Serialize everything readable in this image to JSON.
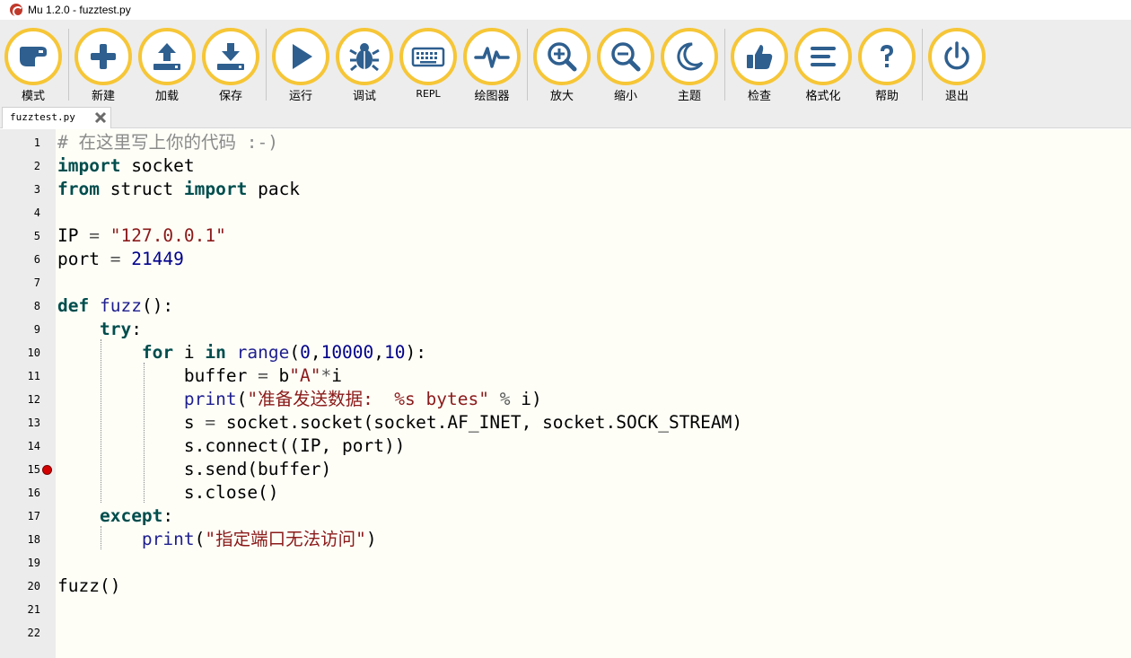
{
  "window": {
    "title": "Mu 1.2.0 - fuzztest.py"
  },
  "toolbar": {
    "buttons": [
      {
        "id": "mode",
        "label": "模式",
        "icon": "mode-icon"
      },
      {
        "id": "new",
        "label": "新建",
        "icon": "plus-icon"
      },
      {
        "id": "load",
        "label": "加载",
        "icon": "upload-icon"
      },
      {
        "id": "save",
        "label": "保存",
        "icon": "download-icon"
      },
      {
        "id": "run",
        "label": "运行",
        "icon": "play-icon"
      },
      {
        "id": "debug",
        "label": "调试",
        "icon": "bug-icon"
      },
      {
        "id": "repl",
        "label": "REPL",
        "icon": "keyboard-icon"
      },
      {
        "id": "plotter",
        "label": "绘图器",
        "icon": "pulse-icon"
      },
      {
        "id": "zoom_in",
        "label": "放大",
        "icon": "zoom-in-icon"
      },
      {
        "id": "zoom_out",
        "label": "缩小",
        "icon": "zoom-out-icon"
      },
      {
        "id": "theme",
        "label": "主题",
        "icon": "moon-icon"
      },
      {
        "id": "check",
        "label": "检查",
        "icon": "thumbs-up-icon"
      },
      {
        "id": "tidy",
        "label": "格式化",
        "icon": "lines-icon"
      },
      {
        "id": "help",
        "label": "帮助",
        "icon": "question-icon"
      },
      {
        "id": "quit",
        "label": "退出",
        "icon": "power-icon"
      }
    ],
    "accent_color": "#f6c637",
    "icon_color": "#2e5f8f"
  },
  "tabs": [
    {
      "name": "fuzztest.py",
      "close_icon": "close-icon"
    }
  ],
  "editor": {
    "line_numbers": [
      "1",
      "2",
      "3",
      "4",
      "5",
      "6",
      "7",
      "8",
      "9",
      "10",
      "11",
      "12",
      "13",
      "14",
      "15",
      "16",
      "17",
      "18",
      "19",
      "20",
      "21",
      "22"
    ],
    "breakpoint_line": "15",
    "lines": [
      [
        {
          "t": "# 在这里写上你的代码 :-)",
          "c": "cm"
        }
      ],
      [
        {
          "t": "import",
          "c": "kw"
        },
        {
          "t": " socket"
        }
      ],
      [
        {
          "t": "from",
          "c": "kw"
        },
        {
          "t": " struct "
        },
        {
          "t": "import",
          "c": "kw"
        },
        {
          "t": " pack"
        }
      ],
      [],
      [
        {
          "t": "IP "
        },
        {
          "t": "=",
          "c": "op"
        },
        {
          "t": " "
        },
        {
          "t": "\"127.0.0.1\"",
          "c": "str"
        }
      ],
      [
        {
          "t": "port "
        },
        {
          "t": "=",
          "c": "op"
        },
        {
          "t": " "
        },
        {
          "t": "21449",
          "c": "num"
        }
      ],
      [],
      [
        {
          "t": "def",
          "c": "kw"
        },
        {
          "t": " "
        },
        {
          "t": "fuzz",
          "c": "fn"
        },
        {
          "t": "():"
        }
      ],
      [
        {
          "t": "    "
        },
        {
          "t": "try",
          "c": "kw"
        },
        {
          "t": ":"
        }
      ],
      [
        {
          "t": "        "
        },
        {
          "t": "for",
          "c": "kw"
        },
        {
          "t": " i "
        },
        {
          "t": "in",
          "c": "kw"
        },
        {
          "t": " "
        },
        {
          "t": "range",
          "c": "bi"
        },
        {
          "t": "("
        },
        {
          "t": "0",
          "c": "num"
        },
        {
          "t": ","
        },
        {
          "t": "10000",
          "c": "num"
        },
        {
          "t": ","
        },
        {
          "t": "10",
          "c": "num"
        },
        {
          "t": "):"
        }
      ],
      [
        {
          "t": "            buffer "
        },
        {
          "t": "=",
          "c": "op"
        },
        {
          "t": " b"
        },
        {
          "t": "\"A\"",
          "c": "str"
        },
        {
          "t": "*",
          "c": "op"
        },
        {
          "t": "i"
        }
      ],
      [
        {
          "t": "            "
        },
        {
          "t": "print",
          "c": "bi"
        },
        {
          "t": "("
        },
        {
          "t": "\"准备发送数据:  %s bytes\"",
          "c": "str"
        },
        {
          "t": " "
        },
        {
          "t": "%",
          "c": "op"
        },
        {
          "t": " i)"
        }
      ],
      [
        {
          "t": "            s "
        },
        {
          "t": "=",
          "c": "op"
        },
        {
          "t": " socket.socket(socket.AF_INET, socket.SOCK_STREAM)"
        }
      ],
      [
        {
          "t": "            s.connect((IP, port))"
        }
      ],
      [
        {
          "t": "            s.send(buffer)"
        }
      ],
      [
        {
          "t": "            s.close()"
        }
      ],
      [
        {
          "t": "    "
        },
        {
          "t": "except",
          "c": "kw"
        },
        {
          "t": ":"
        }
      ],
      [
        {
          "t": "        "
        },
        {
          "t": "print",
          "c": "bi"
        },
        {
          "t": "("
        },
        {
          "t": "\"指定端口无法访问\"",
          "c": "str"
        },
        {
          "t": ")"
        }
      ],
      [],
      [
        {
          "t": "fuzz()"
        }
      ],
      [],
      []
    ]
  }
}
